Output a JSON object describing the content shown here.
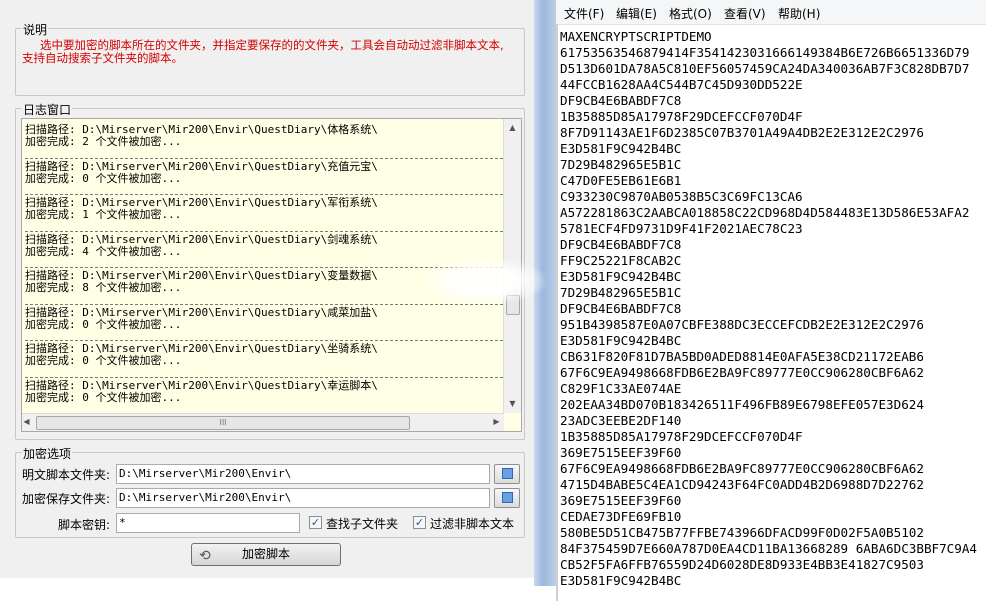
{
  "description": {
    "group_title": "说明",
    "text": "选中要加密的脚本所在的文件夹，并指定要保存的的文件夹，工具会自动动过滤非脚本文本,支持自动搜索子文件夹的脚本。"
  },
  "log": {
    "group_title": "日志窗口",
    "entries": [
      {
        "path": "扫描路径: D:\\Mirserver\\Mir200\\Envir\\QuestDiary\\体格系统\\",
        "result": "加密完成: 2 个文件被加密..."
      },
      {
        "path": "扫描路径: D:\\Mirserver\\Mir200\\Envir\\QuestDiary\\充值元宝\\",
        "result": "加密完成: 0 个文件被加密..."
      },
      {
        "path": "扫描路径: D:\\Mirserver\\Mir200\\Envir\\QuestDiary\\军衔系统\\",
        "result": "加密完成: 1 个文件被加密..."
      },
      {
        "path": "扫描路径: D:\\Mirserver\\Mir200\\Envir\\QuestDiary\\剑魂系统\\",
        "result": "加密完成: 4 个文件被加密..."
      },
      {
        "path": "扫描路径: D:\\Mirserver\\Mir200\\Envir\\QuestDiary\\变量数据\\",
        "result": "加密完成: 8 个文件被加密..."
      },
      {
        "path": "扫描路径: D:\\Mirserver\\Mir200\\Envir\\QuestDiary\\咸菜加盐\\",
        "result": "加密完成: 0 个文件被加密..."
      },
      {
        "path": "扫描路径: D:\\Mirserver\\Mir200\\Envir\\QuestDiary\\坐骑系统\\",
        "result": "加密完成: 0 个文件被加密..."
      },
      {
        "path": "扫描路径: D:\\Mirserver\\Mir200\\Envir\\QuestDiary\\幸运脚本\\",
        "result": "加密完成: 0 个文件被加密..."
      }
    ],
    "hscroll_grip": "III"
  },
  "options": {
    "group_title": "加密选项",
    "source_label": "明文脚本文件夹:",
    "source_value": "D:\\Mirserver\\Mir200\\Envir\\",
    "dest_label": "加密保存文件夹:",
    "dest_value": "D:\\Mirserver\\Mir200\\Envir\\",
    "key_label": "脚本密钥:",
    "key_value": "*",
    "search_subfolders_label": "查找子文件夹",
    "search_subfolders_checked": true,
    "filter_label": "过滤非脚本文本",
    "filter_checked": true,
    "check_mark": "✓"
  },
  "encrypt_button": {
    "label": "加密脚本",
    "icon": "refresh-icon",
    "glyph": "⟲"
  },
  "notepad": {
    "menu": [
      "文件(F)",
      "编辑(E)",
      "格式(O)",
      "查看(V)",
      "帮助(H)"
    ],
    "lines": [
      "MAXENCRYPTSCRIPTDEMO",
      "61753563546879414F3541423031666149384B6E726B6651336D79",
      "D513D601DA78A5C810EF56057459CA24DA340036AB7F3C828DB7D7",
      "44FCCB1628AA4C544B7C45D930DD522E",
      "DF9CB4E6BABDF7C8",
      "1B35885D85A17978F29DCEFCCF070D4F",
      "8F7D91143AE1F6D2385C07B3701A49A4DB2E2E312E2C2976",
      "E3D581F9C942B4BC",
      "7D29B482965E5B1C",
      "C47D0FE5EB61E6B1",
      "C933230C9870AB0538B5C3C69FC13CA6",
      "A572281863C2AABCA018858C22CD968D4D584483E13D586E53AFA2",
      "5781ECF4FD9731D9F41F2021AEC78C23",
      "DF9CB4E6BABDF7C8",
      "FF9C25221F8CAB2C",
      "E3D581F9C942B4BC",
      "7D29B482965E5B1C",
      "DF9CB4E6BABDF7C8",
      "951B4398587E0A07CBFE388DC3ECCEFCDB2E2E312E2C2976",
      "E3D581F9C942B4BC",
      "CB631F820F81D7BA5BD0ADED8814E0AFA5E38CD21172EAB6",
      "67F6C9EA9498668FDB6E2BA9FC89777E0CC906280CBF6A62",
      "C829F1C33AE074AE",
      "202EAA34BD070B183426511F496FB89E6798EFE057E3D624",
      "23ADC3EEBE2DF140",
      "1B35885D85A17978F29DCEFCCF070D4F",
      "369E7515EEF39F60",
      "67F6C9EA9498668FDB6E2BA9FC89777E0CC906280CBF6A62",
      "4715D4BABE5C4EA1CD94243F64FC0ADD4B2D6988D7D22762",
      "369E7515EEF39F60",
      "CEDAE73DFE69FB10",
      "580BE5D51CB475B77FFBE743966DFACD99F0D02F5A0B5102",
      "84F375459D7E660A787D0EA4CD11BA13668289 6ABA6DC3BBF7C9A4",
      "CB52F5FA6FFB76559D24D6028DE8D933E4BB3E41827C9503",
      "E3D581F9C942B4BC"
    ]
  }
}
